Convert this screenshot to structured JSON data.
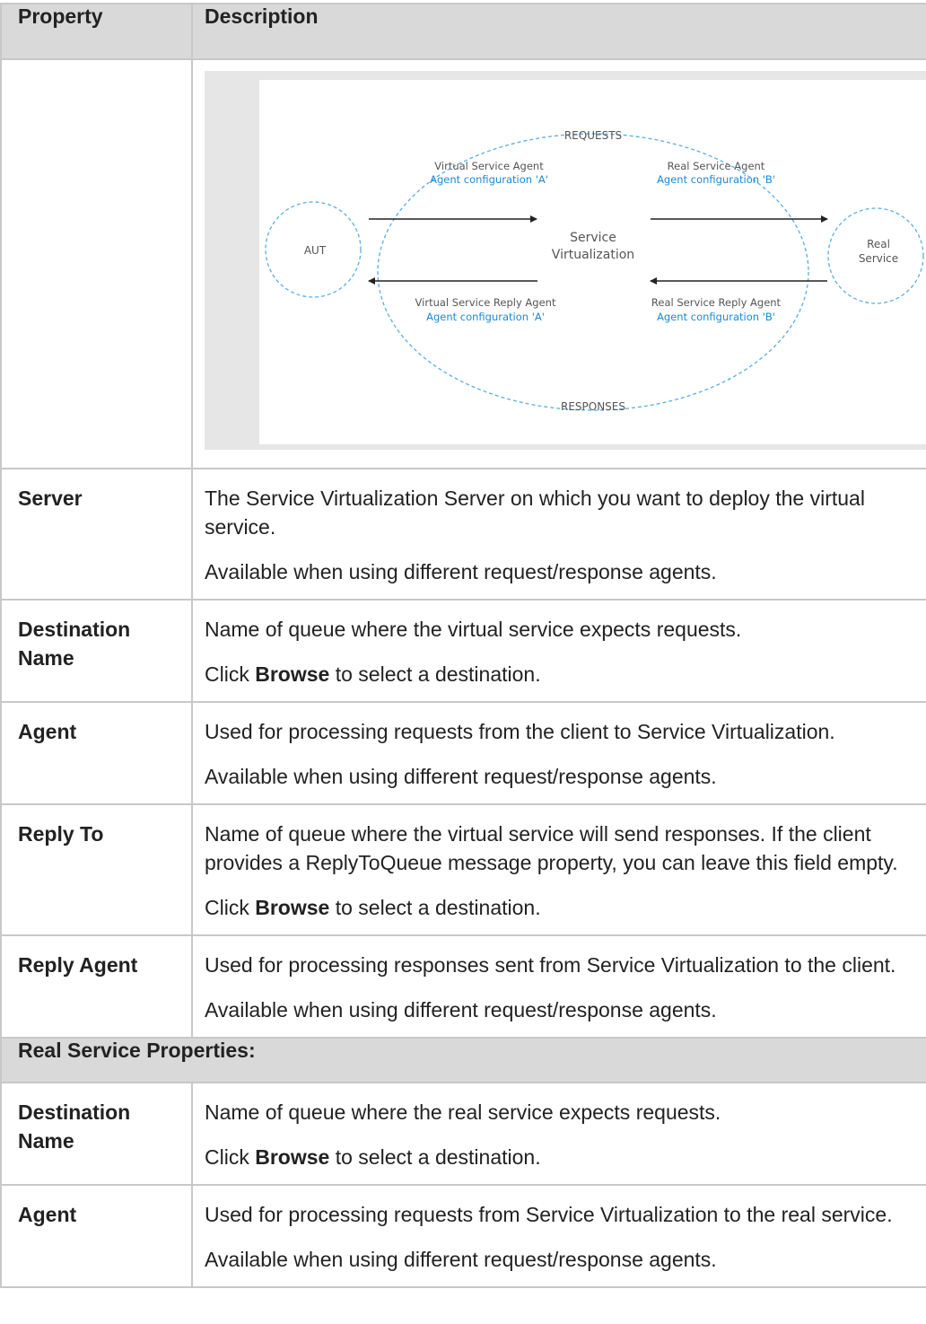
{
  "header": {
    "col1": "Property",
    "col2": "Description"
  },
  "diagram": {
    "requests": "REQUESTS",
    "responses": "RESPONSES",
    "aut": "AUT",
    "sv_line1": "Service",
    "sv_line2": "Virtualization",
    "real_line1": "Real",
    "real_line2": "Service",
    "vs_agent": "Virtual Service Agent",
    "vs_agent_cfg": "Agent configuration 'A'",
    "rs_agent": "Real Service Agent",
    "rs_agent_cfg": "Agent configuration 'B'",
    "vs_reply_agent": "Virtual Service Reply Agent",
    "vs_reply_cfg": "Agent configuration 'A'",
    "rs_reply_agent": "Real Service Reply Agent",
    "rs_reply_cfg": "Agent configuration 'B'",
    "colors": {
      "accent": "#1a8ad4",
      "dashed": "#5aaee6",
      "text": "#555555"
    }
  },
  "rows": [
    {
      "name": "Server",
      "lines": [
        "The Service Virtualization Server on which you want to deploy the virtual service.",
        "Available when using different request/response agents."
      ]
    },
    {
      "name": "Destination Name",
      "lines": [
        "Name of queue where the virtual service expects requests."
      ],
      "browse": {
        "pre": "Click",
        "bold": "Browse",
        "post": "to select a destination."
      }
    },
    {
      "name": "Agent",
      "lines": [
        "Used for processing requests from the client to Service Virtualization.",
        "Available when using different request/response agents."
      ]
    },
    {
      "name": "Reply To",
      "lines": [
        "Name of queue where the virtual service will send responses. If the client provides a ReplyToQueue message property, you can leave this field empty."
      ],
      "browse": {
        "pre": "Click",
        "bold": "Browse",
        "post": "to select a destination."
      }
    },
    {
      "name": "Reply Agent",
      "lines": [
        "Used for processing responses sent from Service Virtualization to the client.",
        "Available when using different request/response agents."
      ]
    }
  ],
  "section": "Real Service Properties:",
  "rows2": [
    {
      "name": "Destination Name",
      "lines": [
        "Name of queue where the real service expects requests."
      ],
      "browse": {
        "pre": "Click",
        "bold": "Browse",
        "post": "to select a destination."
      }
    },
    {
      "name": "Agent",
      "lines": [
        "Used for processing requests from Service Virtualization to the real service.",
        "Available when using different request/response agents."
      ]
    }
  ]
}
